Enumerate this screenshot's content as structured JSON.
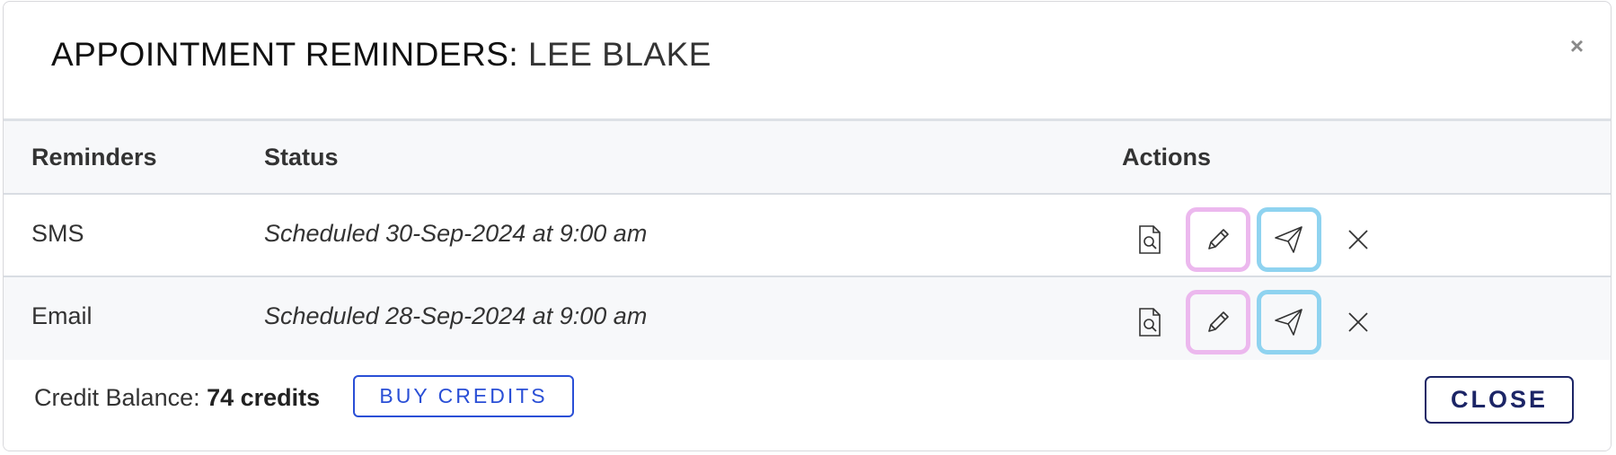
{
  "dialog": {
    "title_prefix": "APPOINTMENT REMINDERS:",
    "title_name": "LEE BLAKE",
    "close_x": "×"
  },
  "table": {
    "headers": {
      "reminders": "Reminders",
      "status": "Status",
      "actions": "Actions"
    },
    "rows": [
      {
        "type": "SMS",
        "status": "Scheduled 30-Sep-2024 at 9:00 am"
      },
      {
        "type": "Email",
        "status": "Scheduled 28-Sep-2024 at 9:00 am"
      }
    ],
    "action_icons": [
      "preview-icon",
      "edit-icon",
      "send-icon",
      "delete-icon"
    ]
  },
  "footer": {
    "credit_label": "Credit Balance:",
    "credit_value": "74 credits",
    "buy_label": "BUY CREDITS",
    "close_label": "CLOSE"
  },
  "colors": {
    "edit_highlight": "#ecb8ee",
    "send_highlight": "#8fd3f0",
    "buy_accent": "#2a4fd6",
    "close_accent": "#1c2566",
    "header_bg": "#f7f8fa"
  }
}
